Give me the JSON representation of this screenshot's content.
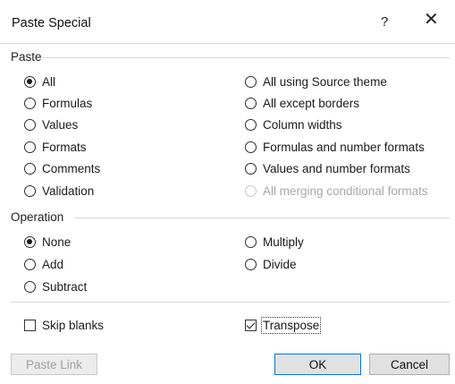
{
  "dialog": {
    "title": "Paste Special",
    "help_label": "?",
    "close_label": "✕"
  },
  "paste": {
    "heading": "Paste",
    "left": [
      {
        "label": "All",
        "checked": true
      },
      {
        "label": "Formulas",
        "checked": false
      },
      {
        "label": "Values",
        "checked": false
      },
      {
        "label": "Formats",
        "checked": false
      },
      {
        "label": "Comments",
        "checked": false
      },
      {
        "label": "Validation",
        "checked": false
      }
    ],
    "right": [
      {
        "label": "All using Source theme",
        "checked": false,
        "disabled": false
      },
      {
        "label": "All except borders",
        "checked": false,
        "disabled": false
      },
      {
        "label": "Column widths",
        "checked": false,
        "disabled": false
      },
      {
        "label": "Formulas and number formats",
        "checked": false,
        "disabled": false
      },
      {
        "label": "Values and number formats",
        "checked": false,
        "disabled": false
      },
      {
        "label": "All merging conditional formats",
        "checked": false,
        "disabled": true
      }
    ]
  },
  "operation": {
    "heading": "Operation",
    "left": [
      {
        "label": "None",
        "checked": true
      },
      {
        "label": "Add",
        "checked": false
      },
      {
        "label": "Subtract",
        "checked": false
      }
    ],
    "right": [
      {
        "label": "Multiply",
        "checked": false
      },
      {
        "label": "Divide",
        "checked": false
      }
    ]
  },
  "checks": {
    "skip_blanks": {
      "label": "Skip blanks",
      "checked": false
    },
    "transpose": {
      "label": "Transpose",
      "checked": true
    }
  },
  "buttons": {
    "paste_link": "Paste Link",
    "ok": "OK",
    "cancel": "Cancel"
  },
  "colors": {
    "accent": "#0078d7",
    "separator": "#d6d6d6",
    "disabled_text": "#a8a8a8"
  }
}
